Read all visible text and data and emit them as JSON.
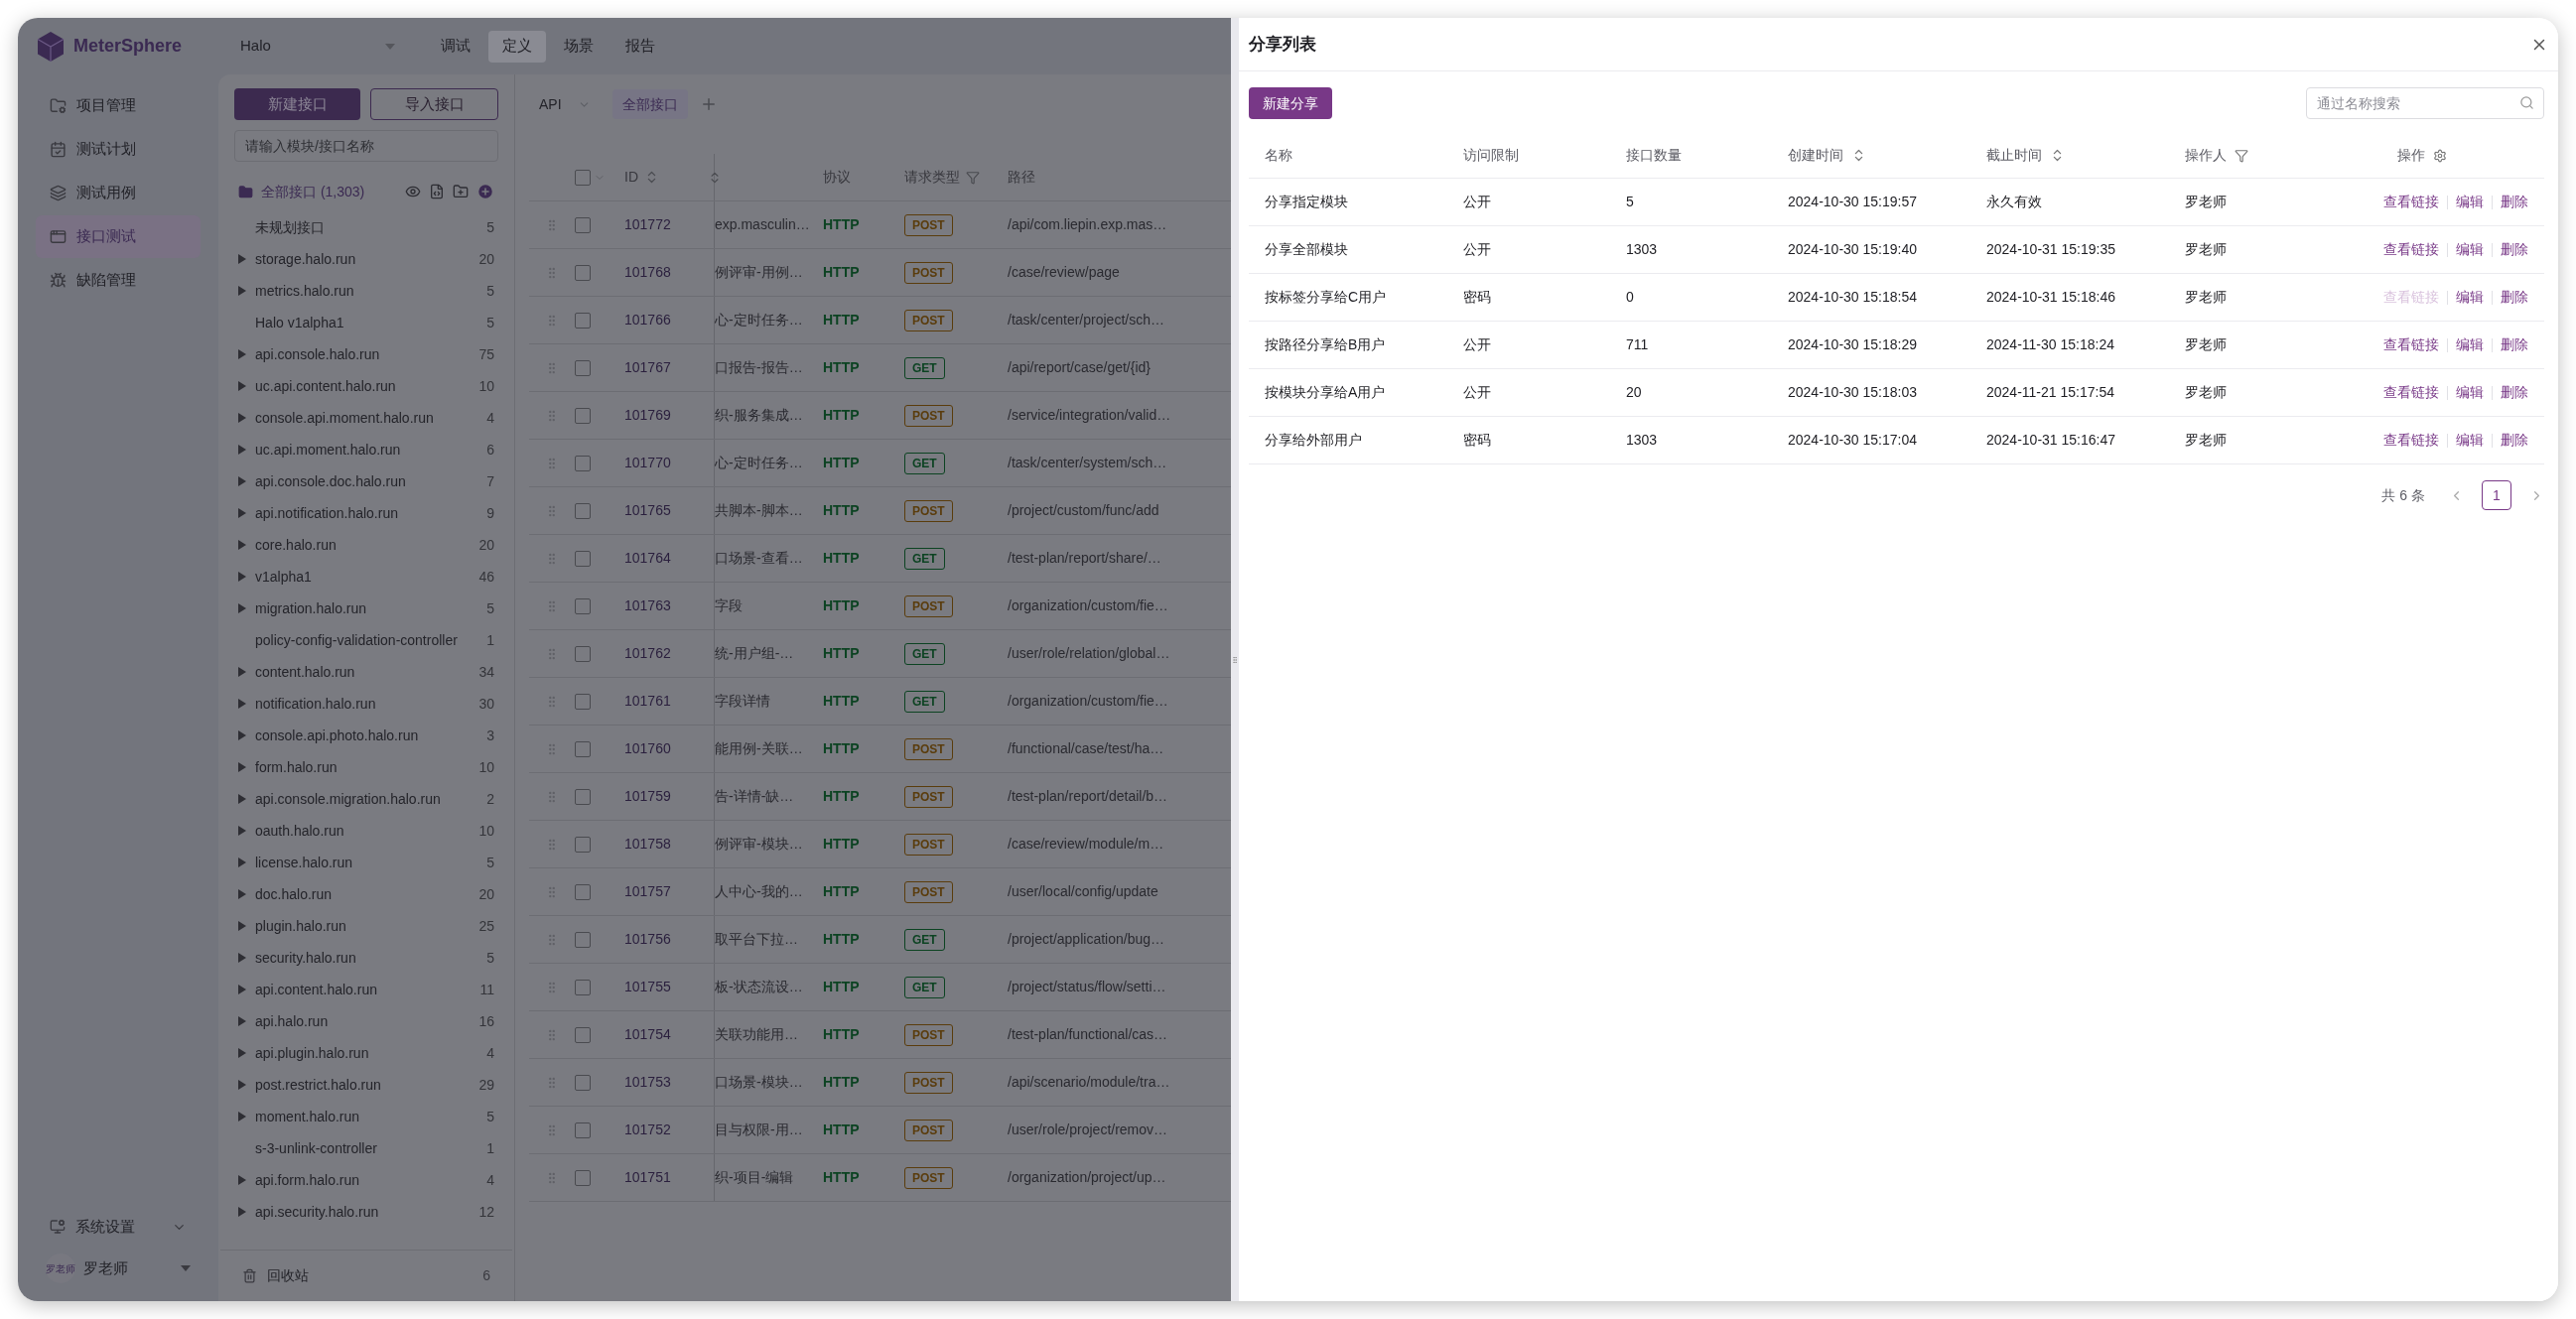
{
  "app": {
    "logo_text": "MeterSphere",
    "project": "Halo",
    "nav": [
      {
        "label": "调试",
        "selected": false
      },
      {
        "label": "定义",
        "selected": true
      },
      {
        "label": "场景",
        "selected": false
      },
      {
        "label": "报告",
        "selected": false
      }
    ],
    "sidebar": [
      {
        "label": "项目管理",
        "selected": false
      },
      {
        "label": "测试计划",
        "selected": false
      },
      {
        "label": "测试用例",
        "selected": false
      },
      {
        "label": "接口测试",
        "selected": true
      },
      {
        "label": "缺陷管理",
        "selected": false
      }
    ],
    "settings": "系统设置",
    "user": {
      "avatar_text": "罗老师",
      "name": "罗老师"
    }
  },
  "module_panel": {
    "buttons": [
      {
        "label": "新建接口",
        "kind": "primary"
      },
      {
        "label": "导入接口",
        "kind": "outline"
      }
    ],
    "search": {
      "placeholder": "请输入模块/接口名称"
    },
    "root": "全部接口 (1,303)",
    "modules": [
      {
        "label": "未规划接口",
        "count": "5",
        "expandable": false
      },
      {
        "label": "storage.halo.run",
        "count": "20",
        "expandable": true
      },
      {
        "label": "metrics.halo.run",
        "count": "5",
        "expandable": true
      },
      {
        "label": "Halo v1alpha1",
        "count": "5",
        "expandable": false
      },
      {
        "label": "api.console.halo.run",
        "count": "75",
        "expandable": true
      },
      {
        "label": "uc.api.content.halo.run",
        "count": "10",
        "expandable": true
      },
      {
        "label": "console.api.moment.halo.run",
        "count": "4",
        "expandable": true
      },
      {
        "label": "uc.api.moment.halo.run",
        "count": "6",
        "expandable": true
      },
      {
        "label": "api.console.doc.halo.run",
        "count": "7",
        "expandable": true
      },
      {
        "label": "api.notification.halo.run",
        "count": "9",
        "expandable": true
      },
      {
        "label": "core.halo.run",
        "count": "20",
        "expandable": true
      },
      {
        "label": "v1alpha1",
        "count": "46",
        "expandable": true
      },
      {
        "label": "migration.halo.run",
        "count": "5",
        "expandable": true
      },
      {
        "label": "policy-config-validation-controller",
        "count": "1",
        "expandable": false
      },
      {
        "label": "content.halo.run",
        "count": "34",
        "expandable": true
      },
      {
        "label": "notification.halo.run",
        "count": "30",
        "expandable": true
      },
      {
        "label": "console.api.photo.halo.run",
        "count": "3",
        "expandable": true
      },
      {
        "label": "form.halo.run",
        "count": "10",
        "expandable": true
      },
      {
        "label": "api.console.migration.halo.run",
        "count": "2",
        "expandable": true
      },
      {
        "label": "oauth.halo.run",
        "count": "10",
        "expandable": true
      },
      {
        "label": "license.halo.run",
        "count": "5",
        "expandable": true
      },
      {
        "label": "doc.halo.run",
        "count": "20",
        "expandable": true
      },
      {
        "label": "plugin.halo.run",
        "count": "25",
        "expandable": true
      },
      {
        "label": "security.halo.run",
        "count": "5",
        "expandable": true
      },
      {
        "label": "api.content.halo.run",
        "count": "11",
        "expandable": true
      },
      {
        "label": "api.halo.run",
        "count": "16",
        "expandable": true
      },
      {
        "label": "api.plugin.halo.run",
        "count": "4",
        "expandable": true
      },
      {
        "label": "post.restrict.halo.run",
        "count": "29",
        "expandable": true
      },
      {
        "label": "moment.halo.run",
        "count": "5",
        "expandable": true
      },
      {
        "label": "s-3-unlink-controller",
        "count": "1",
        "expandable": false
      },
      {
        "label": "api.form.halo.run",
        "count": "4",
        "expandable": true
      },
      {
        "label": "api.security.halo.run",
        "count": "12",
        "expandable": true
      }
    ],
    "recycle_bin": {
      "label": "回收站",
      "count": "6"
    }
  },
  "api_table": {
    "protocol_select": "API",
    "select_all_checked": false,
    "tabs": [
      {
        "label": "全部接口",
        "selected": true
      }
    ],
    "columns": [
      {
        "label": "ID",
        "kind": "sort"
      },
      {
        "label": "协议",
        "kind": "plain"
      },
      {
        "label": "请求类型",
        "kind": "filter"
      },
      {
        "label": "路径",
        "kind": "plain"
      }
    ],
    "rows": [
      {
        "id": "101772",
        "column_3": "exp.masculin…",
        "protocol": "HTTP",
        "method": "POST",
        "color": "#5a3c0c",
        "path": "/api/com.liepin.exp.mas…",
        "checked": false
      },
      {
        "id": "101768",
        "column_3": "例评审-用例…",
        "protocol": "HTTP",
        "method": "POST",
        "color": "#5a3c0c",
        "path": "/case/review/page",
        "checked": false
      },
      {
        "id": "101766",
        "column_3": "心-定时任务…",
        "protocol": "HTTP",
        "method": "POST",
        "color": "#5a3c0c",
        "path": "/task/center/project/sch…",
        "checked": false
      },
      {
        "id": "101767",
        "column_3": "口报告-报告…",
        "protocol": "HTTP",
        "method": "GET",
        "color": "#0c4322",
        "path": "/api/report/case/get/{id}",
        "checked": false
      },
      {
        "id": "101769",
        "column_3": "织-服务集成…",
        "protocol": "HTTP",
        "method": "POST",
        "color": "#5a3c0c",
        "path": "/service/integration/valid…",
        "checked": false
      },
      {
        "id": "101770",
        "column_3": "心-定时任务…",
        "protocol": "HTTP",
        "method": "GET",
        "color": "#0c4322",
        "path": "/task/center/system/sch…",
        "checked": false
      },
      {
        "id": "101765",
        "column_3": "共脚本-脚本…",
        "protocol": "HTTP",
        "method": "POST",
        "color": "#5a3c0c",
        "path": "/project/custom/func/add",
        "checked": false
      },
      {
        "id": "101764",
        "column_3": "口场景-查看…",
        "protocol": "HTTP",
        "method": "GET",
        "color": "#0c4322",
        "path": "/test-plan/report/share/…",
        "checked": false
      },
      {
        "id": "101763",
        "column_3": "字段",
        "protocol": "HTTP",
        "method": "POST",
        "color": "#5a3c0c",
        "path": "/organization/custom/fie…",
        "checked": false
      },
      {
        "id": "101762",
        "column_3": "统-用户组-…",
        "protocol": "HTTP",
        "method": "GET",
        "color": "#0c4322",
        "path": "/user/role/relation/global…",
        "checked": false
      },
      {
        "id": "101761",
        "column_3": "字段详情",
        "protocol": "HTTP",
        "method": "GET",
        "color": "#0c4322",
        "path": "/organization/custom/fie…",
        "checked": false
      },
      {
        "id": "101760",
        "column_3": "能用例-关联…",
        "protocol": "HTTP",
        "method": "POST",
        "color": "#5a3c0c",
        "path": "/functional/case/test/ha…",
        "checked": false
      },
      {
        "id": "101759",
        "column_3": "告-详情-缺…",
        "protocol": "HTTP",
        "method": "POST",
        "color": "#5a3c0c",
        "path": "/test-plan/report/detail/b…",
        "checked": false
      },
      {
        "id": "101758",
        "column_3": "例评审-模块…",
        "protocol": "HTTP",
        "method": "POST",
        "color": "#5a3c0c",
        "path": "/case/review/module/m…",
        "checked": false
      },
      {
        "id": "101757",
        "column_3": "人中心-我的…",
        "protocol": "HTTP",
        "method": "POST",
        "color": "#5a3c0c",
        "path": "/user/local/config/update",
        "checked": false
      },
      {
        "id": "101756",
        "column_3": "取平台下拉…",
        "protocol": "HTTP",
        "method": "GET",
        "color": "#0c4322",
        "path": "/project/application/bug…",
        "checked": false
      },
      {
        "id": "101755",
        "column_3": "板-状态流设…",
        "protocol": "HTTP",
        "method": "GET",
        "color": "#0c4322",
        "path": "/project/status/flow/setti…",
        "checked": false
      },
      {
        "id": "101754",
        "column_3": "关联功能用…",
        "protocol": "HTTP",
        "method": "POST",
        "color": "#5a3c0c",
        "path": "/test-plan/functional/cas…",
        "checked": false
      },
      {
        "id": "101753",
        "column_3": "口场景-模块…",
        "protocol": "HTTP",
        "method": "POST",
        "color": "#5a3c0c",
        "path": "/api/scenario/module/tra…",
        "checked": false
      },
      {
        "id": "101752",
        "column_3": "目与权限-用…",
        "protocol": "HTTP",
        "method": "POST",
        "color": "#5a3c0c",
        "path": "/user/role/project/remov…",
        "checked": false
      },
      {
        "id": "101751",
        "column_3": "织-项目-编辑",
        "protocol": "HTTP",
        "method": "POST",
        "color": "#5a3c0c",
        "path": "/organization/project/up…",
        "checked": false
      }
    ]
  },
  "drawer": {
    "title": "分享列表",
    "new_button": "新建分享",
    "search": {
      "placeholder": "通过名称搜索"
    },
    "columns": [
      {
        "label": "名称",
        "kind": "plain"
      },
      {
        "label": "访问限制",
        "kind": "plain"
      },
      {
        "label": "接口数量",
        "kind": "plain"
      },
      {
        "label": "创建时间",
        "kind": "sort"
      },
      {
        "label": "截止时间",
        "kind": "sort"
      },
      {
        "label": "操作人",
        "kind": "filter"
      },
      {
        "label": "操作",
        "kind": "settings"
      }
    ],
    "rows": [
      {
        "name": "分享指定模块",
        "access": "公开",
        "count": "5",
        "created": "2024-10-30 15:19:57",
        "deadline": "永久有效",
        "operator": "罗老师",
        "actions": [
          {
            "label": "查看链接",
            "disabled": false
          },
          {
            "label": "编辑",
            "disabled": false
          },
          {
            "label": "删除",
            "disabled": false
          }
        ]
      },
      {
        "name": "分享全部模块",
        "access": "公开",
        "count": "1303",
        "created": "2024-10-30 15:19:40",
        "deadline": "2024-10-31 15:19:35",
        "operator": "罗老师",
        "actions": [
          {
            "label": "查看链接",
            "disabled": false
          },
          {
            "label": "编辑",
            "disabled": false
          },
          {
            "label": "删除",
            "disabled": false
          }
        ]
      },
      {
        "name": "按标签分享给C用户",
        "access": "密码",
        "count": "0",
        "created": "2024-10-30 15:18:54",
        "deadline": "2024-10-31 15:18:46",
        "operator": "罗老师",
        "actions": [
          {
            "label": "查看链接",
            "disabled": true
          },
          {
            "label": "编辑",
            "disabled": false
          },
          {
            "label": "删除",
            "disabled": false
          }
        ]
      },
      {
        "name": "按路径分享给B用户",
        "access": "公开",
        "count": "711",
        "created": "2024-10-30 15:18:29",
        "deadline": "2024-11-30 15:18:24",
        "operator": "罗老师",
        "actions": [
          {
            "label": "查看链接",
            "disabled": false
          },
          {
            "label": "编辑",
            "disabled": false
          },
          {
            "label": "删除",
            "disabled": false
          }
        ]
      },
      {
        "name": "按模块分享给A用户",
        "access": "公开",
        "count": "20",
        "created": "2024-10-30 15:18:03",
        "deadline": "2024-11-21 15:17:54",
        "operator": "罗老师",
        "actions": [
          {
            "label": "查看链接",
            "disabled": false
          },
          {
            "label": "编辑",
            "disabled": false
          },
          {
            "label": "删除",
            "disabled": false
          }
        ]
      },
      {
        "name": "分享给外部用户",
        "access": "密码",
        "count": "1303",
        "created": "2024-10-30 15:17:04",
        "deadline": "2024-10-31 15:16:47",
        "operator": "罗老师",
        "actions": [
          {
            "label": "查看链接",
            "disabled": false
          },
          {
            "label": "编辑",
            "disabled": false
          },
          {
            "label": "删除",
            "disabled": false
          }
        ]
      }
    ],
    "pagination": {
      "total": "共 6 条",
      "pages": [
        {
          "label": "1",
          "selected": true
        }
      ]
    }
  }
}
